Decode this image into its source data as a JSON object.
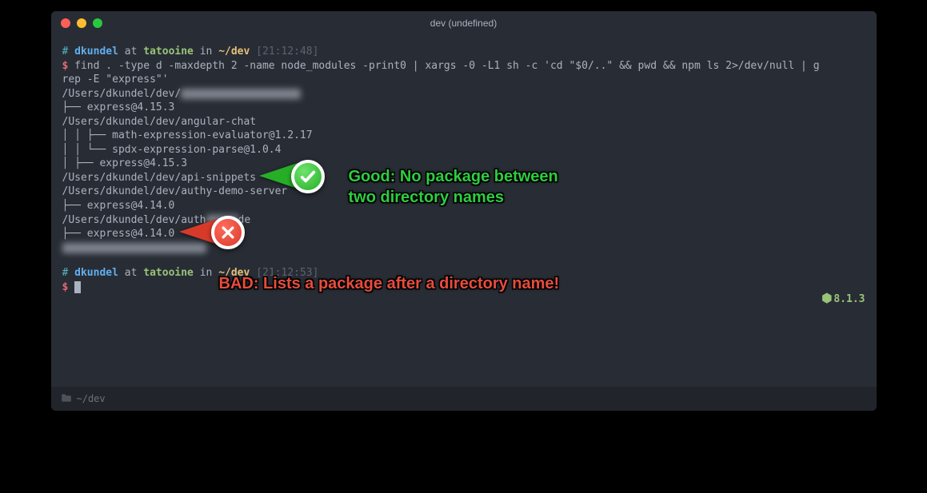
{
  "window": {
    "title": "dev (undefined)"
  },
  "prompt1": {
    "hash": "#",
    "user": "dkundel",
    "at": "at",
    "host": "tatooine",
    "in": "in",
    "cwd": "~/dev",
    "time": "[21:12:48]",
    "dollar": "$",
    "command": "find . -type d -maxdepth 2 -name node_modules -print0 | xargs -0 -L1 sh -c 'cd \"$0/..\" && pwd && npm ls 2>/dev/null | g",
    "command2": "rep -E \"express\"'"
  },
  "output": {
    "l1a": "/Users/dkundel/dev/",
    "l2": "├── express@4.15.3",
    "l3": "/Users/dkundel/dev/angular-chat",
    "l4": "│ │ ├── math-expression-evaluator@1.2.17",
    "l5": "│ │ └── spdx-expression-parse@1.0.4",
    "l6": "│ ├── express@4.15.3",
    "l7": "/Users/dkundel/dev/api-snippets",
    "l8": "/Users/dkundel/dev/authy-demo-server",
    "l9": "├── express@4.14.0",
    "l10a": "/Users/dkundel/dev/auth",
    "l10b": "de",
    "l11": "├── express@4.14.0"
  },
  "prompt2": {
    "hash": "#",
    "user": "dkundel",
    "at": "at",
    "host": "tatooine",
    "in": "in",
    "cwd": "~/dev",
    "time": "[21:12:53]",
    "dollar": "$"
  },
  "node_version": "8.1.3",
  "statusbar": {
    "path": "~/dev"
  },
  "annotations": {
    "good_line1": "Good: No package between",
    "good_line2": "two directory names",
    "bad": "BAD: Lists a package after a directory name!"
  }
}
